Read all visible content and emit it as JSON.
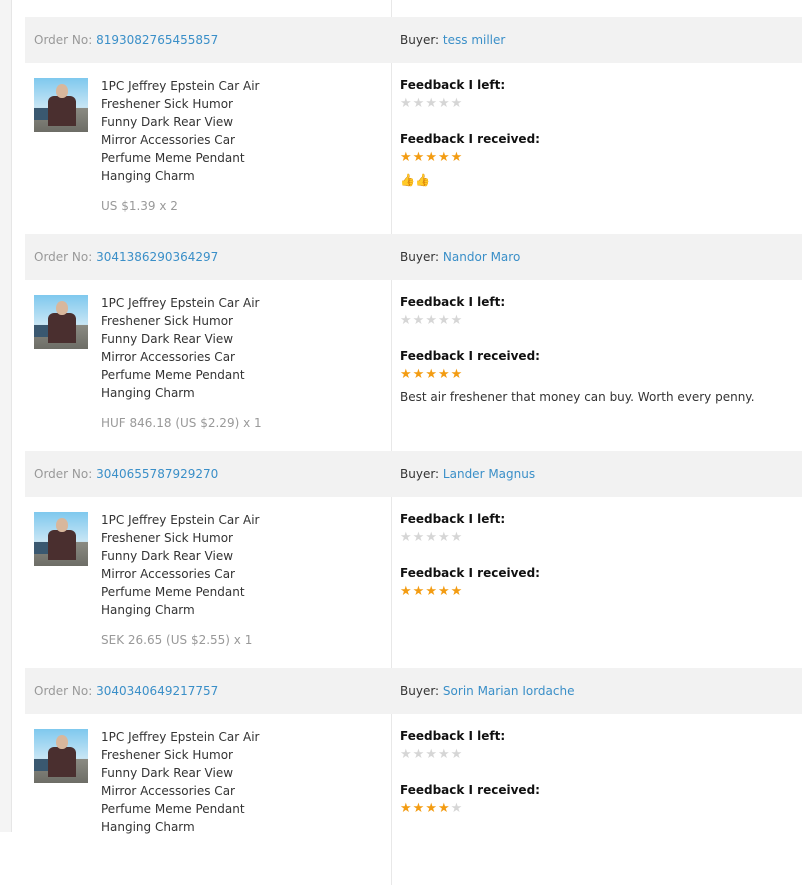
{
  "labels": {
    "order_no": "Order No:",
    "buyer": "Buyer:",
    "feedback_left": "Feedback I left:",
    "feedback_received": "Feedback I received:"
  },
  "product": {
    "title": "1PC Jeffrey Epstein Car Air Freshener Sick Humor Funny Dark Rear View Mirror Accessories Car Perfume Meme Pendant Hanging Charm",
    "thumbnail_icon": "product-photo"
  },
  "colors": {
    "link": "#3a8fc8",
    "star_active": "#f39c12",
    "star_inactive": "#d6d6d6",
    "header_bg": "#f2f2f2"
  },
  "orders": [
    {
      "order_no": "8193082765455857",
      "buyer": "tess miller",
      "price": "US $1.39 x 2",
      "stars_left": 0,
      "stars_received": 5,
      "comment": "👍👍"
    },
    {
      "order_no": "3041386290364297",
      "buyer": "Nandor Maro",
      "price": "HUF 846.18 (US $2.29) x 1",
      "stars_left": 0,
      "stars_received": 5,
      "comment": "Best air freshener that money can buy. Worth every penny."
    },
    {
      "order_no": "3040655787929270",
      "buyer": "Lander Magnus",
      "price": "SEK 26.65 (US $2.55) x 1",
      "stars_left": 0,
      "stars_received": 5,
      "comment": ""
    },
    {
      "order_no": "3040340649217757",
      "buyer": "Sorin Marian Iordache",
      "price": "",
      "stars_left": 0,
      "stars_received": 4,
      "comment": ""
    }
  ]
}
